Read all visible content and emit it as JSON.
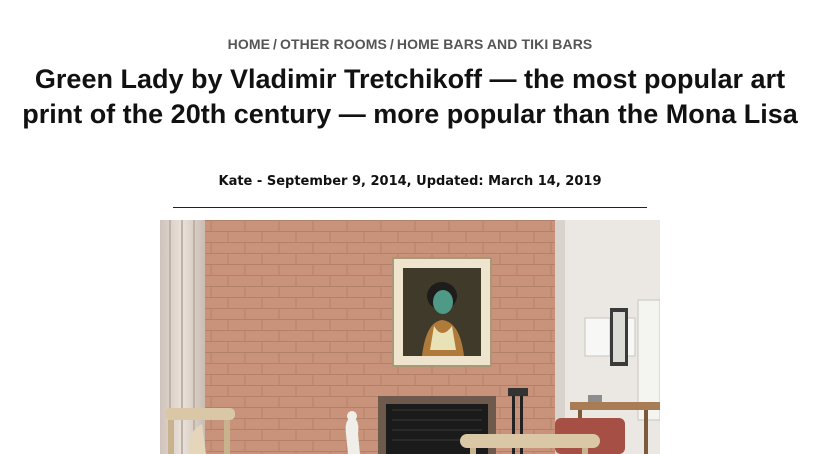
{
  "breadcrumb": {
    "items": [
      "HOME",
      "OTHER ROOMS",
      "HOME BARS AND TIKI BARS"
    ],
    "separator": "/"
  },
  "article": {
    "title": "Green Lady by Vladimir Tretchikoff — the most popular art print of the 20th century — more popular than the Mona Lisa",
    "author": "Kate",
    "meta_separator": " - ",
    "date": "September 9, 2014",
    "updated_label": ", Updated: ",
    "updated_date": "March 14, 2019"
  },
  "colors": {
    "brick": "#c58f73",
    "wall_right": "#e9e6e1",
    "frame": "#e8dcc4",
    "lady_skin": "#4f9a86",
    "firebox": "#1b1b1b",
    "chair_wood": "#d9c7a5"
  },
  "image": {
    "icon": "living-room-photo"
  }
}
